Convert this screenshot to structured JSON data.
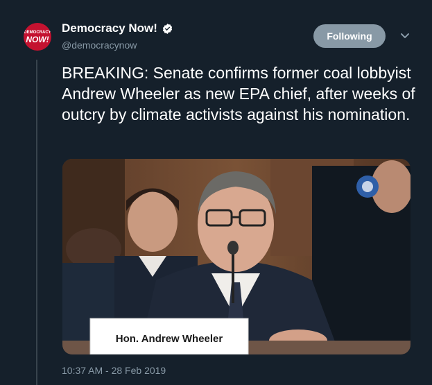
{
  "account": {
    "display_name": "Democracy Now!",
    "handle": "@democracynow",
    "avatar_line1": "DEMOCRACY",
    "avatar_line2": "NOW!"
  },
  "follow_button": {
    "label": "Following"
  },
  "tweet": {
    "text": "BREAKING: Senate confirms former coal lobbyist Andrew Wheeler as new EPA chief, after weeks of outcry by climate activists against his nomination.",
    "timestamp": "10:37 AM - 28 Feb 2019"
  },
  "media": {
    "nameplate": "Hon. Andrew Wheeler"
  },
  "icons": {
    "verified": "verified-badge-icon",
    "more": "chevron-down-icon"
  },
  "colors": {
    "background": "#15202b",
    "secondary_text": "#8899a6",
    "button": "#8899a6",
    "verified_badge": "#ffffff",
    "brand_red": "#c41230"
  }
}
